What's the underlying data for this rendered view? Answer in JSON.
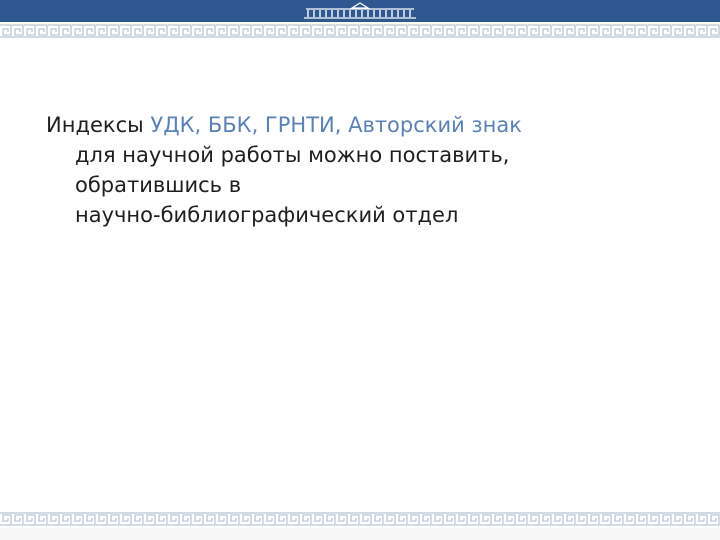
{
  "slide": {
    "text": {
      "lead": "Индексы",
      "highlight": "УДК, ББК, ГРНТИ, Авторский знак",
      "line2": "для научной работы  можно поставить,",
      "line3": "обратившись в",
      "line4": "научно-библиографический отдел"
    }
  },
  "colors": {
    "header_bar": "#2f5890",
    "highlight": "#5b82b5",
    "border_pattern": "#b9c6d6",
    "text": "#1f1f1f"
  },
  "icons": {
    "logo": "building-colonnade-icon",
    "border": "greek-key-pattern"
  }
}
